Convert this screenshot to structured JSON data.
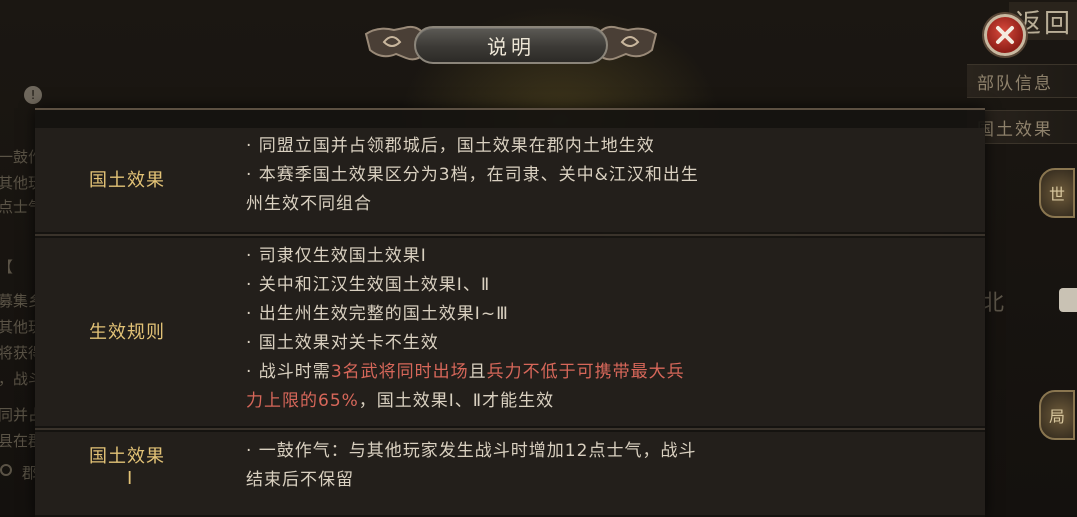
{
  "title": "说明",
  "back_button": "返回",
  "background": {
    "tabs": [
      "部队信息",
      "国土效果"
    ],
    "left_texts": [
      "一鼓作气】",
      "其他玩家",
      "点士气，战斗结束后不保",
      "【",
      "募集乡勇】",
      "其他玩家",
      "将获得",
      "，战斗结束后不保留",
      "同并占领郡城后，国土效",
      "县在郡内",
      "郡城"
    ],
    "side_buttons": [
      "世",
      "局"
    ],
    "north": "北"
  },
  "sections": [
    {
      "label": "国土效果",
      "lines": [
        [
          {
            "t": "· 同盟立国并占领郡城后，国土效果在郡内土地生效"
          }
        ],
        [
          {
            "t": "· 本赛季国土效果区分为3档，在司隶、关中&江汉和出生"
          }
        ],
        [
          {
            "t": "州生效不同组合"
          }
        ]
      ]
    },
    {
      "label": "生效规则",
      "lines": [
        [
          {
            "t": "· 司隶仅生效国土效果Ⅰ"
          }
        ],
        [
          {
            "t": "· 关中和江汉生效国土效果Ⅰ、Ⅱ"
          }
        ],
        [
          {
            "t": "· 出生州生效完整的国土效果Ⅰ~Ⅲ"
          }
        ],
        [
          {
            "t": "· 国土效果对关卡不生效"
          }
        ],
        [
          {
            "t": "· 战斗时需"
          },
          {
            "t": "3名武将同时出场",
            "hl": true
          },
          {
            "t": "且"
          },
          {
            "t": "兵力不低于可携带最大兵",
            "hl": true
          }
        ],
        [
          {
            "t": "力上限的65%",
            "hl": true
          },
          {
            "t": "，国土效果Ⅰ、Ⅱ才能生效"
          }
        ]
      ]
    },
    {
      "label": "国土效果",
      "label2": "Ⅰ",
      "lines": [
        [
          {
            "t": "· 一鼓作气：与其他玩家发生战斗时增加12点士气，战斗"
          }
        ],
        [
          {
            "t": "结束后不保留"
          }
        ]
      ]
    }
  ],
  "colors": {
    "label": "#e2c276",
    "text": "#d9d0c0",
    "highlight": "#d7675a"
  }
}
